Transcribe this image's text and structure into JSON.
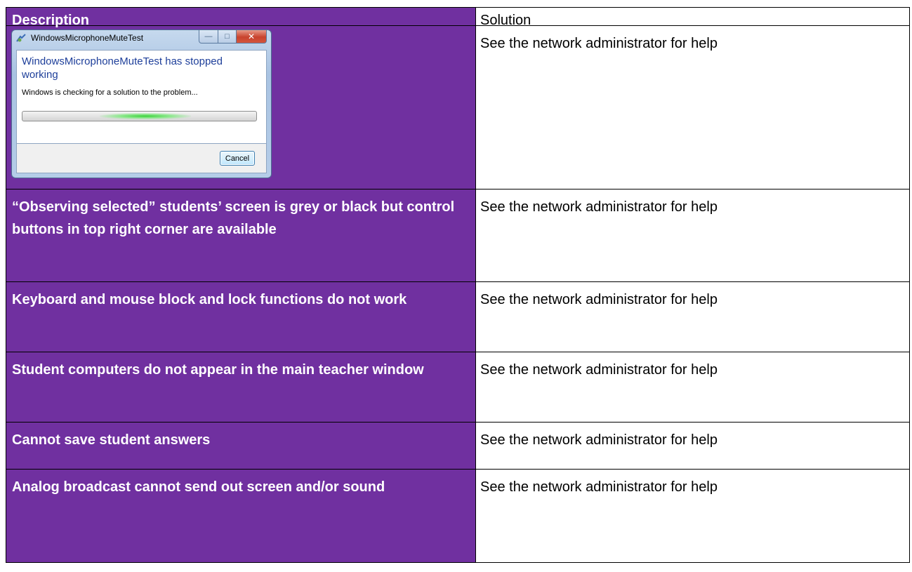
{
  "table": {
    "header": {
      "description": "Description",
      "solution": "Solution"
    },
    "rows": [
      {
        "description": "",
        "solution": "See the network administrator for help"
      },
      {
        "description": "“Observing selected” students’ screen is grey or black but control buttons in top right corner are available",
        "solution": "See the network administrator for help"
      },
      {
        "description": "Keyboard and mouse block and lock functions do not work",
        "solution": "See the network administrator for help"
      },
      {
        "description": "Student computers do not appear in the main teacher window",
        "solution": "See the network administrator for help"
      },
      {
        "description": "Cannot save student answers",
        "solution": "See the network administrator for help"
      },
      {
        "description": "Analog broadcast cannot send out screen and/or sound",
        "solution": "See the network administrator for help"
      }
    ]
  },
  "dialog": {
    "title": "WindowsMicrophoneMuteTest",
    "heading": "WindowsMicrophoneMuteTest has stopped working",
    "message": "Windows is checking for a solution to the problem...",
    "cancel_label": "Cancel",
    "icons": {
      "app": "app-icon",
      "minimize": "minimize-icon",
      "maximize": "maximize-icon",
      "close": "close-icon"
    }
  },
  "colors": {
    "description_bg": "#7030a0",
    "dialog_heading": "#1e3f9a",
    "progress_glow": "#3bd23b"
  }
}
